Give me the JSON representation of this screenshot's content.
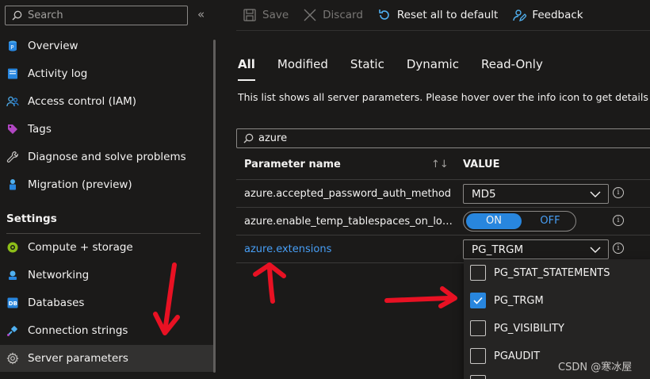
{
  "sidebar": {
    "search_placeholder": "Search",
    "items": [
      {
        "label": "Overview",
        "icon": "overview-icon"
      },
      {
        "label": "Activity log",
        "icon": "activity-log-icon"
      },
      {
        "label": "Access control (IAM)",
        "icon": "iam-icon"
      },
      {
        "label": "Tags",
        "icon": "tag-icon"
      },
      {
        "label": "Diagnose and solve problems",
        "icon": "wrench-icon"
      },
      {
        "label": "Migration (preview)",
        "icon": "migration-icon"
      }
    ],
    "settings_header": "Settings",
    "settings_items": [
      {
        "label": "Compute + storage",
        "icon": "compute-icon"
      },
      {
        "label": "Networking",
        "icon": "networking-icon"
      },
      {
        "label": "Databases",
        "icon": "database-icon",
        "badge": "DB"
      },
      {
        "label": "Connection strings",
        "icon": "connection-icon"
      },
      {
        "label": "Server parameters",
        "icon": "gear-icon",
        "active": true
      }
    ]
  },
  "toolbar": {
    "save": "Save",
    "discard": "Discard",
    "reset": "Reset all to default",
    "feedback": "Feedback"
  },
  "tabs": [
    {
      "label": "All",
      "active": true
    },
    {
      "label": "Modified"
    },
    {
      "label": "Static"
    },
    {
      "label": "Dynamic"
    },
    {
      "label": "Read-Only"
    }
  ],
  "info_text": "This list shows all server parameters. Please hover over the info icon to get details about",
  "filter": {
    "value": "azure"
  },
  "table": {
    "col_param": "Parameter name",
    "col_value": "VALUE",
    "rows": [
      {
        "name": "azure.accepted_password_auth_method",
        "value": "MD5"
      },
      {
        "name": "azure.enable_temp_tablespaces_on_local_ssd",
        "on": "ON",
        "off": "OFF",
        "state": "ON"
      },
      {
        "name": "azure.extensions",
        "value": "PG_TRGM"
      }
    ]
  },
  "dropdown": {
    "options": [
      {
        "label": "PG_STAT_STATEMENTS",
        "checked": false
      },
      {
        "label": "PG_TRGM",
        "checked": true
      },
      {
        "label": "PG_VISIBILITY",
        "checked": false
      },
      {
        "label": "PGAUDIT",
        "checked": false
      }
    ]
  },
  "watermark": "CSDN @寒冰屋",
  "colors": {
    "accent": "#2886de",
    "link": "#479ef5",
    "annotation": "#e81123",
    "background": "#1b1a19"
  }
}
